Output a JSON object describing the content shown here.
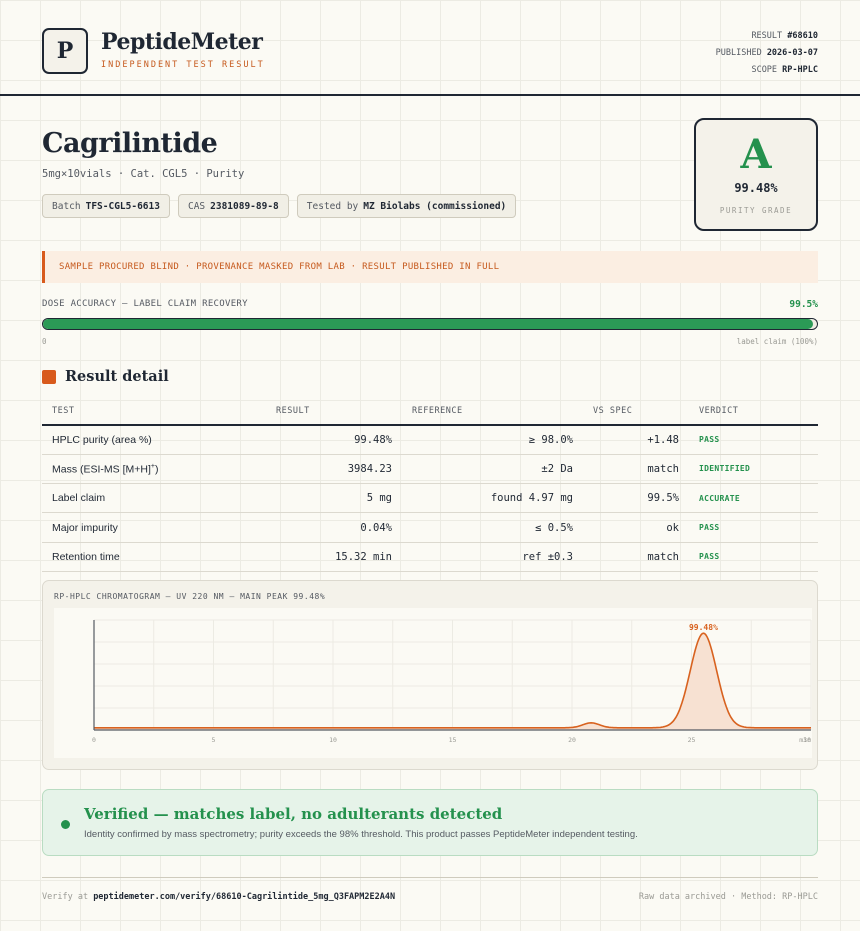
{
  "brand": {
    "logo_letter": "P",
    "name": "PeptideMeter",
    "tagline": "INDEPENDENT TEST RESULT"
  },
  "meta": {
    "result_label": "RESULT",
    "result_value": "#68610",
    "published_label": "PUBLISHED",
    "published_value": "2026-03-07",
    "scope_label": "SCOPE",
    "scope_value": "RP-HPLC"
  },
  "product": {
    "name": "Cagrilintide",
    "subtitle": "5mg×10vials · Cat. CGL5 · Purity",
    "chips": [
      {
        "label": "Batch",
        "value": "TFS-CGL5-6613"
      },
      {
        "label": "CAS",
        "value": "2381089-89-8"
      },
      {
        "label": "Tested by",
        "value": "MZ Biolabs (commissioned)"
      }
    ]
  },
  "grade": {
    "letter": "A",
    "value": "99.48%",
    "label": "PURITY GRADE"
  },
  "notice": "SAMPLE PROCURED BLIND · PROVENANCE MASKED FROM LAB · RESULT PUBLISHED IN FULL",
  "dose": {
    "label": "DOSE ACCURACY — LABEL CLAIM RECOVERY",
    "value_text": "99.5%",
    "fraction": 0.995,
    "min_label": "0",
    "max_label": "label claim (100%)"
  },
  "results": {
    "title": "Result detail",
    "headers": [
      "TEST",
      "RESULT",
      "REFERENCE",
      "VS SPEC",
      "VERDICT"
    ],
    "rows": [
      {
        "test": "HPLC purity (area %)",
        "result": "99.48%",
        "reference": "≥ 98.0%",
        "vs_spec": "+1.48",
        "verdict": "PASS"
      },
      {
        "test": "Mass (ESI-MS [M+H]",
        "test_sup": "+",
        "test_end": ")",
        "result": "3984.23",
        "reference": "±2 Da",
        "vs_spec": "match",
        "verdict": "IDENTIFIED"
      },
      {
        "test": "Label claim",
        "result": "5 mg",
        "reference": "found 4.97 mg",
        "vs_spec": "99.5%",
        "verdict": "ACCURATE"
      },
      {
        "test": "Major impurity",
        "result": "0.04%",
        "reference": "≤ 0.5%",
        "vs_spec": "ok",
        "verdict": "PASS"
      },
      {
        "test": "Retention time",
        "result": "15.32 min",
        "reference": "ref ±0.3",
        "vs_spec": "match",
        "verdict": "PASS"
      }
    ]
  },
  "chart_data": {
    "type": "line",
    "title": "RP-HPLC CHROMATOGRAM — UV 220 NM — MAIN PEAK 99.48%",
    "xlabel": "",
    "ylabel": "",
    "xlim": [
      0,
      30
    ],
    "ylim": [
      0,
      100
    ],
    "x_ticks": [
      0,
      5,
      10,
      15,
      20,
      25,
      30
    ],
    "x_tick_labels": [
      "0",
      "5",
      "10",
      "15",
      "20",
      "25",
      "30"
    ],
    "x_unit_label": "min",
    "baseline": 2,
    "peaks": [
      {
        "x": 20.8,
        "height": 4.5,
        "width": 0.35
      },
      {
        "x": 25.5,
        "height": 86,
        "width": 0.55
      }
    ],
    "annotations": [
      {
        "x": 25.5,
        "y": 88,
        "text": "99.48%"
      }
    ],
    "color": "#d8621f",
    "fill": "#f7e1d2",
    "grid": true
  },
  "verified": {
    "title": "Verified — matches label, no adulterants detected",
    "text": "Identity confirmed by mass spectrometry; purity exceeds the 98% threshold. This product passes PeptideMeter independent testing."
  },
  "footer": {
    "verify_label": "Verify at",
    "verify_url": "peptidemeter.com/verify/68610-Cagrilintide_5mg_Q3FAPM2E2A4N",
    "right": "Raw data archived · Method: RP-HPLC"
  },
  "colors": {
    "accent": "#d85a1c",
    "pass": "#24914d",
    "ink": "#1f2733"
  }
}
